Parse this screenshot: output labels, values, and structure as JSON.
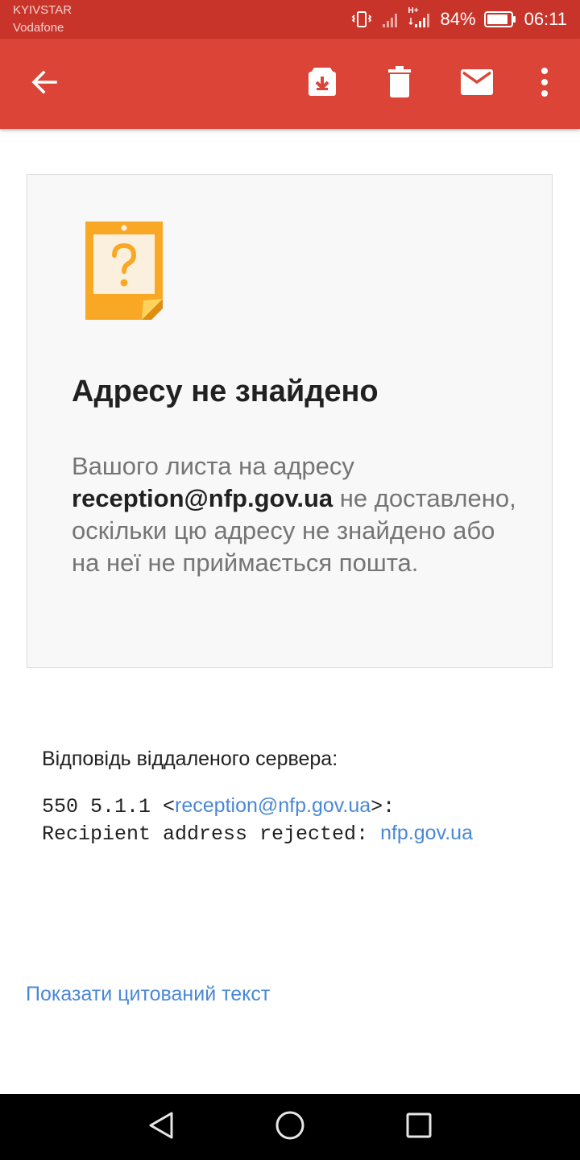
{
  "status_bar": {
    "carrier_1": "KYIVSTAR",
    "carrier_2": "Vodafone",
    "network_type": "H+",
    "battery_percent": "84%",
    "time": "06:11",
    "icons": [
      "vibrate-icon",
      "signal-icon",
      "signal-icon",
      "battery-icon"
    ]
  },
  "app_bar": {
    "background_color": "#db4437",
    "actions": [
      "back-icon",
      "archive-icon",
      "delete-icon",
      "mark-unread-icon",
      "more-icon"
    ]
  },
  "card": {
    "icon": "question-note-icon",
    "title": "Адресу не знайдено",
    "body_before": "Вашого листа на адресу ",
    "address": "reception@nfp.gov.ua",
    "body_after": " не доставлено, оскільки цю адресу не знайдено або на неї не приймається пошта."
  },
  "server": {
    "label": "Відповідь віддаленого сервера:",
    "code_prefix": "550 5.1.1 <",
    "code_address": "reception@nfp.gov.ua",
    "code_suffix": ">:",
    "line2_prefix": "Recipient address rejected: ",
    "line2_domain": "nfp.gov.ua"
  },
  "show_quoted_text": "Показати цитований текст",
  "nav_bar": {
    "buttons": [
      "back-triangle-icon",
      "home-circle-icon",
      "recents-square-icon"
    ]
  },
  "colors": {
    "accent_red": "#db4437",
    "status_red": "#c9342a",
    "link_blue": "#4a88d6",
    "icon_orange": "#f9a825"
  }
}
